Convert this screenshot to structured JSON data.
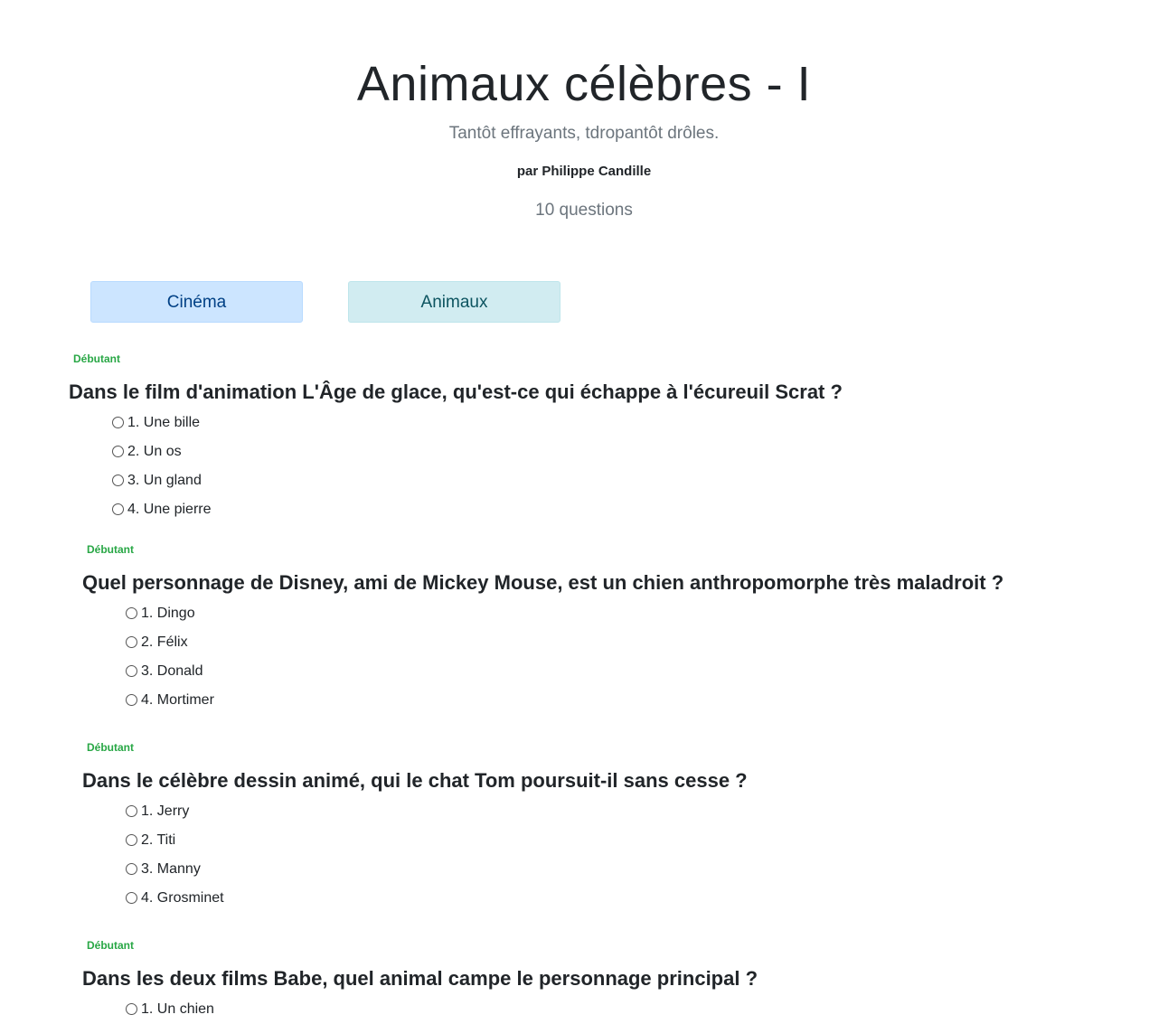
{
  "quiz": {
    "title": "Animaux célèbres - I",
    "subtitle": "Tantôt effrayants, tdropantôt drôles.",
    "author": "par Philippe Candille",
    "count": "10 questions"
  },
  "tags": [
    {
      "label": "Cinéma"
    },
    {
      "label": "Animaux"
    }
  ],
  "colors": {
    "level_green": "#28a745",
    "tag_cinema_bg": "#cce5ff",
    "tag_animaux_bg": "#d1ecf1"
  },
  "questions": [
    {
      "level": "Débutant",
      "text": "Dans le film d'animation L'Âge de glace, qu'est-ce qui échappe à l'écureuil Scrat ?",
      "answers": [
        "1. Une bille",
        "2. Un os",
        "3. Un gland",
        "4. Une pierre"
      ]
    },
    {
      "level": "Débutant",
      "text": "Quel personnage de Disney, ami de Mickey Mouse, est un chien anthropomorphe très maladroit ?",
      "answers": [
        "1. Dingo",
        "2. Félix",
        "3. Donald",
        "4. Mortimer"
      ]
    },
    {
      "level": "Débutant",
      "text": "Dans le célèbre dessin animé, qui le chat Tom poursuit-il sans cesse ?",
      "answers": [
        "1. Jerry",
        "2. Titi",
        "3. Manny",
        "4. Grosminet"
      ]
    },
    {
      "level": "Débutant",
      "text": "Dans les deux films Babe, quel animal campe le personnage principal ?",
      "answers": [
        "1. Un chien"
      ]
    }
  ]
}
